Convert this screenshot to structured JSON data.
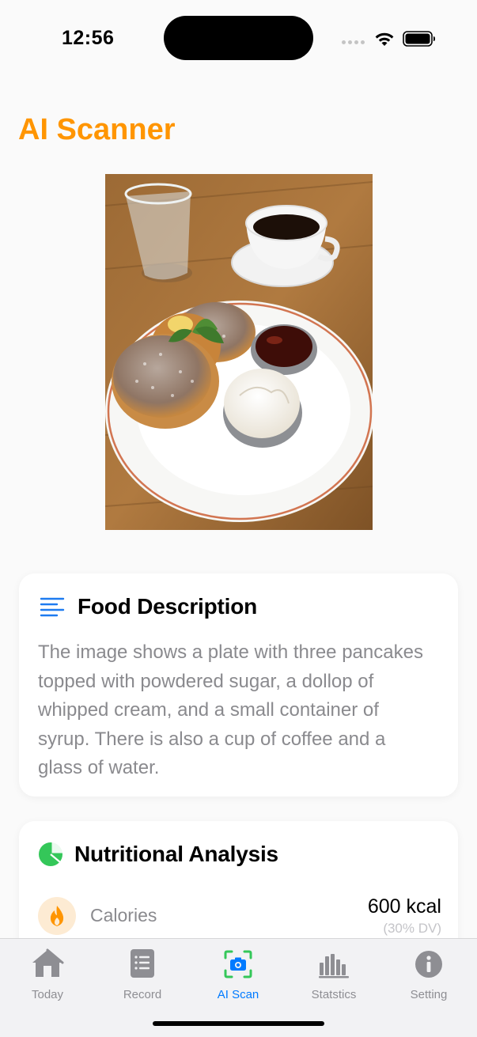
{
  "status_bar": {
    "time": "12:56"
  },
  "page": {
    "title": "AI Scanner",
    "accent_color": "#ff9500"
  },
  "food_description": {
    "title": "Food Description",
    "icon": "text-align-left-icon",
    "text": "The image shows a plate with three pancakes topped with powdered sugar, a dollop of whipped cream, and a small container of syrup. There is also a cup of coffee and a glass of water."
  },
  "nutritional_analysis": {
    "title": "Nutritional Analysis",
    "icon": "pie-chart-icon",
    "rows": [
      {
        "icon": "flame-icon",
        "label": "Calories",
        "value": "600 kcal",
        "dv": "(30% DV)"
      }
    ]
  },
  "tab_bar": {
    "tabs": [
      {
        "label": "Today",
        "icon": "house-icon",
        "active": false
      },
      {
        "label": "Record",
        "icon": "list-icon",
        "active": false
      },
      {
        "label": "AI Scan",
        "icon": "camera-viewfinder-icon",
        "active": true
      },
      {
        "label": "Statstics",
        "icon": "bar-chart-icon",
        "active": false
      },
      {
        "label": "Setting",
        "icon": "info-icon",
        "active": false
      }
    ],
    "active_color": "#007aff",
    "inactive_color": "#8e8e93"
  }
}
